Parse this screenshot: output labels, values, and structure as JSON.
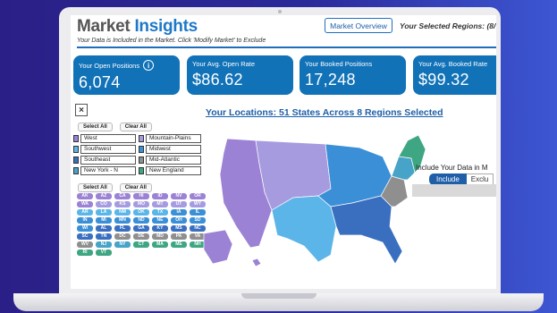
{
  "header": {
    "title_part1": "Market ",
    "title_part2": "Insights",
    "subtitle": "Your Data is Included in the Market. Click 'Modify Market' to Exclude",
    "tab_overview": "Market Overview",
    "tab_regions": "Your Selected Regions: (8/"
  },
  "kpis": [
    {
      "label": "Your Open Positions",
      "value": "6,074",
      "has_info": true
    },
    {
      "label": "Your Avg. Open Rate",
      "value": "$86.62"
    },
    {
      "label": "Your Booked Positions",
      "value": "17,248"
    },
    {
      "label": "Your Avg. Booked Rate",
      "value": "$99.32"
    }
  ],
  "filter_panel": {
    "close_glyph": "×",
    "select_all": "Select All",
    "clear_all": "Clear All",
    "regions": [
      {
        "label": "West",
        "color": "#9b82d4"
      },
      {
        "label": "Mountain-Plains",
        "color": "#a79be0"
      },
      {
        "label": "Southwest",
        "color": "#5bb5e8"
      },
      {
        "label": "Midwest",
        "color": "#3b8fd6"
      },
      {
        "label": "Southeast",
        "color": "#3a6fc0"
      },
      {
        "label": "Mid-Atlantic",
        "color": "#8f8f8f"
      },
      {
        "label": "New York - N",
        "color": "#47a3c7"
      },
      {
        "label": "New England",
        "color": "#3ea682"
      }
    ],
    "states": [
      {
        "abbr": "AK",
        "color": "#9b82d4"
      },
      {
        "abbr": "AZ",
        "color": "#9b82d4"
      },
      {
        "abbr": "CA",
        "color": "#9b82d4"
      },
      {
        "abbr": "HI",
        "color": "#9b82d4"
      },
      {
        "abbr": "ID",
        "color": "#9b82d4"
      },
      {
        "abbr": "NV",
        "color": "#9b82d4"
      },
      {
        "abbr": "OR",
        "color": "#9b82d4"
      },
      {
        "abbr": "WA",
        "color": "#9b82d4"
      },
      {
        "abbr": "CO",
        "color": "#a79be0"
      },
      {
        "abbr": "KS",
        "color": "#a79be0"
      },
      {
        "abbr": "MO",
        "color": "#a79be0"
      },
      {
        "abbr": "MT",
        "color": "#a79be0"
      },
      {
        "abbr": "UT",
        "color": "#a79be0"
      },
      {
        "abbr": "WY",
        "color": "#a79be0"
      },
      {
        "abbr": "AR",
        "color": "#5bb5e8"
      },
      {
        "abbr": "LA",
        "color": "#5bb5e8"
      },
      {
        "abbr": "NM",
        "color": "#5bb5e8"
      },
      {
        "abbr": "OK",
        "color": "#5bb5e8"
      },
      {
        "abbr": "TX",
        "color": "#5bb5e8"
      },
      {
        "abbr": "IA",
        "color": "#3b8fd6"
      },
      {
        "abbr": "IL",
        "color": "#3b8fd6"
      },
      {
        "abbr": "IN",
        "color": "#3b8fd6"
      },
      {
        "abbr": "MI",
        "color": "#3b8fd6"
      },
      {
        "abbr": "MN",
        "color": "#3b8fd6"
      },
      {
        "abbr": "ND",
        "color": "#3b8fd6"
      },
      {
        "abbr": "NE",
        "color": "#3b8fd6"
      },
      {
        "abbr": "OH",
        "color": "#3b8fd6"
      },
      {
        "abbr": "SD",
        "color": "#3b8fd6"
      },
      {
        "abbr": "WI",
        "color": "#3b8fd6"
      },
      {
        "abbr": "AL",
        "color": "#3a6fc0"
      },
      {
        "abbr": "FL",
        "color": "#3a6fc0"
      },
      {
        "abbr": "GA",
        "color": "#3a6fc0"
      },
      {
        "abbr": "KY",
        "color": "#3a6fc0"
      },
      {
        "abbr": "MS",
        "color": "#3a6fc0"
      },
      {
        "abbr": "NC",
        "color": "#3a6fc0"
      },
      {
        "abbr": "SC",
        "color": "#3a6fc0"
      },
      {
        "abbr": "TN",
        "color": "#3a6fc0"
      },
      {
        "abbr": "DC",
        "color": "#8f8f8f"
      },
      {
        "abbr": "DE",
        "color": "#8f8f8f"
      },
      {
        "abbr": "MD",
        "color": "#8f8f8f"
      },
      {
        "abbr": "PA",
        "color": "#8f8f8f"
      },
      {
        "abbr": "VA",
        "color": "#8f8f8f"
      },
      {
        "abbr": "WV",
        "color": "#8f8f8f"
      },
      {
        "abbr": "NJ",
        "color": "#47a3c7"
      },
      {
        "abbr": "NY",
        "color": "#47a3c7"
      },
      {
        "abbr": "CT",
        "color": "#3ea682"
      },
      {
        "abbr": "MA",
        "color": "#3ea682"
      },
      {
        "abbr": "ME",
        "color": "#3ea682"
      },
      {
        "abbr": "NH",
        "color": "#3ea682"
      },
      {
        "abbr": "RI",
        "color": "#3ea682"
      },
      {
        "abbr": "VT",
        "color": "#3ea682"
      }
    ]
  },
  "main": {
    "locations_title": "Your Locations: 51 States Across 8 Regions Selected",
    "include_label": "Include Your Data in M",
    "toggle_include": "Include",
    "toggle_exclude": "Exclu"
  }
}
